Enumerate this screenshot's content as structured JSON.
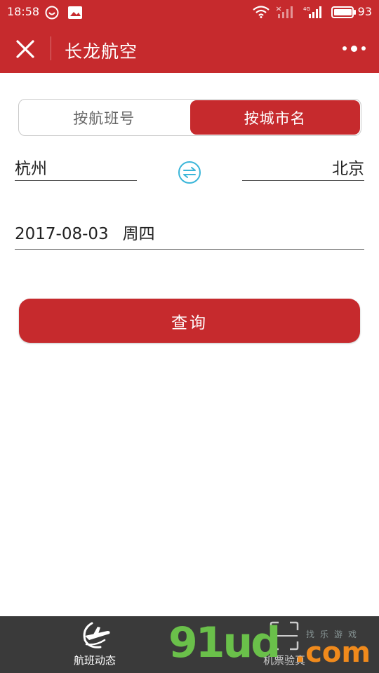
{
  "status_bar": {
    "time": "18:58",
    "battery_percent": "93",
    "network_label": "4G",
    "icons": [
      "whatsapp-icon",
      "gallery-notification-icon",
      "wifi-icon",
      "signal-icon",
      "signal-4g-icon",
      "battery-icon"
    ]
  },
  "header": {
    "title": "长龙航空",
    "close_icon": "close-icon",
    "more_icon": "more-dots-icon"
  },
  "search_mode": {
    "tabs": [
      {
        "label": "按航班号",
        "selected": false
      },
      {
        "label": "按城市名",
        "selected": true
      }
    ]
  },
  "route": {
    "from_city": "杭州",
    "to_city": "北京",
    "swap_icon": "swap-arrows-icon"
  },
  "date": {
    "value": "2017-08-03",
    "weekday": "周四"
  },
  "query_button": {
    "label": "查询"
  },
  "bottom_nav": {
    "items": [
      {
        "label": "航班动态",
        "icon": "airplane-icon"
      },
      {
        "label": "机票验真",
        "icon": "scan-frame-icon"
      }
    ]
  },
  "watermark": {
    "text": "91ud",
    "suffix": ".com",
    "tagline": "找乐游戏"
  },
  "colors": {
    "brand_red": "#c62a2d",
    "swap_blue": "#3bb6d9",
    "nav_background": "#3a3a3a"
  }
}
